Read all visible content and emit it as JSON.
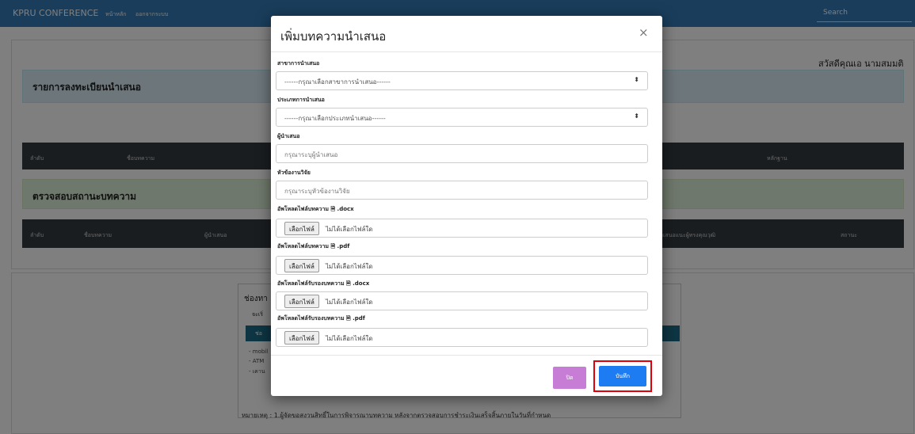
{
  "navbar": {
    "brand": "KPRU CONFERENCE",
    "links": [
      "หน้าหลัก",
      "ออกจากระบบ"
    ],
    "search": "Search"
  },
  "page": {
    "greeting": "สวัสดีคุณเอ นามสมมติ",
    "registration_title": "รายการลงทะเบียนนำเสนอ",
    "table1_headers": [
      "ลำดับ",
      "ชื่อบทความ",
      "หลักฐาน"
    ],
    "status_title": "ตรวจสอบสถานะบทความ",
    "table2_headers": [
      "ลำดับ",
      "ชื่อบทความ",
      "ผู้นำเสนอ",
      "ข้อเสนอแนะผู้ทรงคุณวุฒิ",
      "สถานะ"
    ],
    "payment_title": "ช่องทา",
    "payment_sub": "จะเริ่",
    "payment_bar": "ช่อ",
    "payment_lines": [
      "- mobil",
      "- ATM",
      "- เคาน"
    ],
    "note": "หมายเหตุ : 1.ผู้จัดขอสงวนสิทธิ์ในการพิจารณาบทความ หลังจากตรวจสอบการชำระเงินเสร็จสิ้นภายในวันที่กำหนด"
  },
  "modal": {
    "title": "เพิ่มบทความนำเสนอ",
    "close_symbol": "×",
    "fields": [
      {
        "label": "สาขาการนำเสนอ",
        "value": "------กรุณาเลือกสาขาการนำเสนอ------"
      },
      {
        "label": "ประเภทการนำเสนอ",
        "value": "------กรุณาเลือกประเภทนำเสนอ------"
      },
      {
        "label": "ผู้นำเสนอ",
        "placeholder": "กรุณาระบุผู้นำเสนอ"
      },
      {
        "label": "หัวข้องานวิจัย",
        "placeholder": "กรุณาระบุหัวข้องานวิจัย"
      },
      {
        "label": "อัพโหลดไฟล์บทความ",
        "ext": ".docx"
      },
      {
        "label": "อัพโหลดไฟล์บทความ",
        "ext": ".pdf"
      },
      {
        "label": "อัพโหลดไฟล์รับรองบทความ",
        "ext": ".docx"
      },
      {
        "label": "อัพโหลดไฟล์รับรองบทความ",
        "ext": ".pdf"
      }
    ],
    "file_button": "เลือกไฟล์",
    "no_file": "ไม่ได้เลือกไฟล์ใด",
    "close_button": "ปิด",
    "save_button": "บันทึก"
  },
  "colors": {
    "navbar": "#337ab7",
    "save": "#1d7cf2",
    "close": "#c77dd6",
    "highlight": "#e0000a"
  },
  "icons": {
    "select_arrow": "updown-arrow-icon",
    "file": "file-icon"
  }
}
